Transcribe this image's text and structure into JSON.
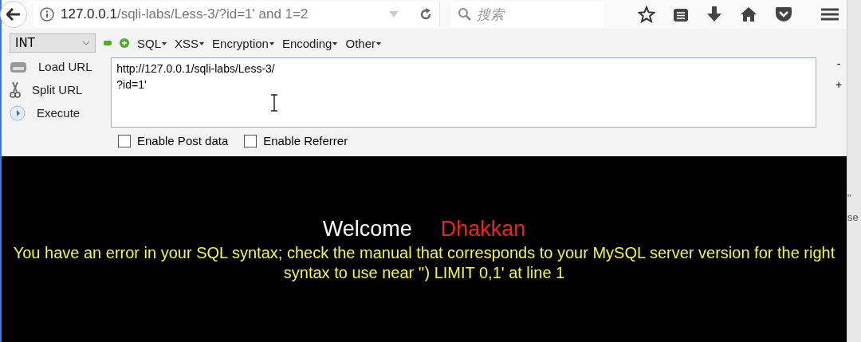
{
  "toolbar": {
    "url_host": "127.0.0.1",
    "url_path": "/sqli-labs/Less-3/?id=1' and 1=2",
    "search_placeholder": "搜索"
  },
  "hackbar": {
    "select_value": "INT",
    "menus": [
      "SQL",
      "XSS",
      "Encryption",
      "Encoding",
      "Other"
    ],
    "actions": [
      "Load URL",
      "Split URL",
      "Execute"
    ],
    "url_text": [
      "http://127.0.0.1/sqli-labs/Less-3/",
      "?id=1'"
    ],
    "side_buttons": [
      "-",
      "+"
    ],
    "options": [
      {
        "label": "Enable Post data",
        "checked": false
      },
      {
        "label": "Enable Referrer",
        "checked": false
      }
    ]
  },
  "page": {
    "welcome": "Welcome",
    "name": "Dhakkan",
    "error": "You have an error in your SQL syntax; check the manual that corresponds to your MySQL server version for the right syntax to use near '') LIMIT 0,1' at line 1"
  },
  "background_window": {
    "texts": [
      "\"",
      "se"
    ]
  }
}
